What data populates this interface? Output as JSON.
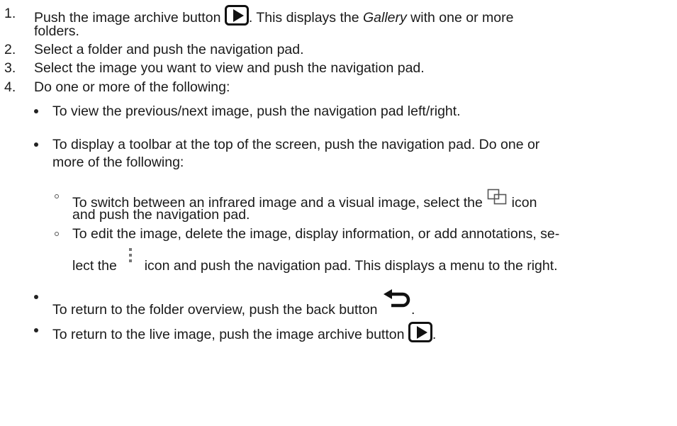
{
  "steps": [
    {
      "number": "1.",
      "pre": "Push the image archive button",
      "post_a": ". This displays the ",
      "post_em": "Gallery",
      "post_b": " with one or more",
      "cont": "folders."
    },
    {
      "number": "2.",
      "text": "Select a folder and push the navigation pad."
    },
    {
      "number": "3.",
      "text": "Select the image you want to view and push the navigation pad."
    },
    {
      "number": "4.",
      "text": "Do one or more of the following:"
    }
  ],
  "bullets": [
    {
      "text": "To view the previous/next image, push the navigation pad left/right."
    },
    {
      "line1": "To display a toolbar at the top of the screen, push the navigation pad. Do one or",
      "line2": "more of the following:"
    },
    {
      "pre": "To return to the folder overview, push the back button",
      "post": "."
    },
    {
      "pre": "To return to the live image, push the image archive button",
      "post": "."
    }
  ],
  "sub_bullets": [
    {
      "pre": "To switch between an infrared image and a visual image, select the",
      "post": "icon",
      "line2": "and push the navigation pad."
    },
    {
      "line1": "To edit the image, delete the image, display information, or add annotations, se-",
      "pre": "lect the",
      "post": "icon and push the navigation pad. This displays a menu to the right."
    }
  ],
  "icons": {
    "image_archive": "play-button-icon",
    "switch_image": "overlapping-squares-icon",
    "more": "vertical-dots-icon",
    "back": "back-arrow-icon"
  }
}
